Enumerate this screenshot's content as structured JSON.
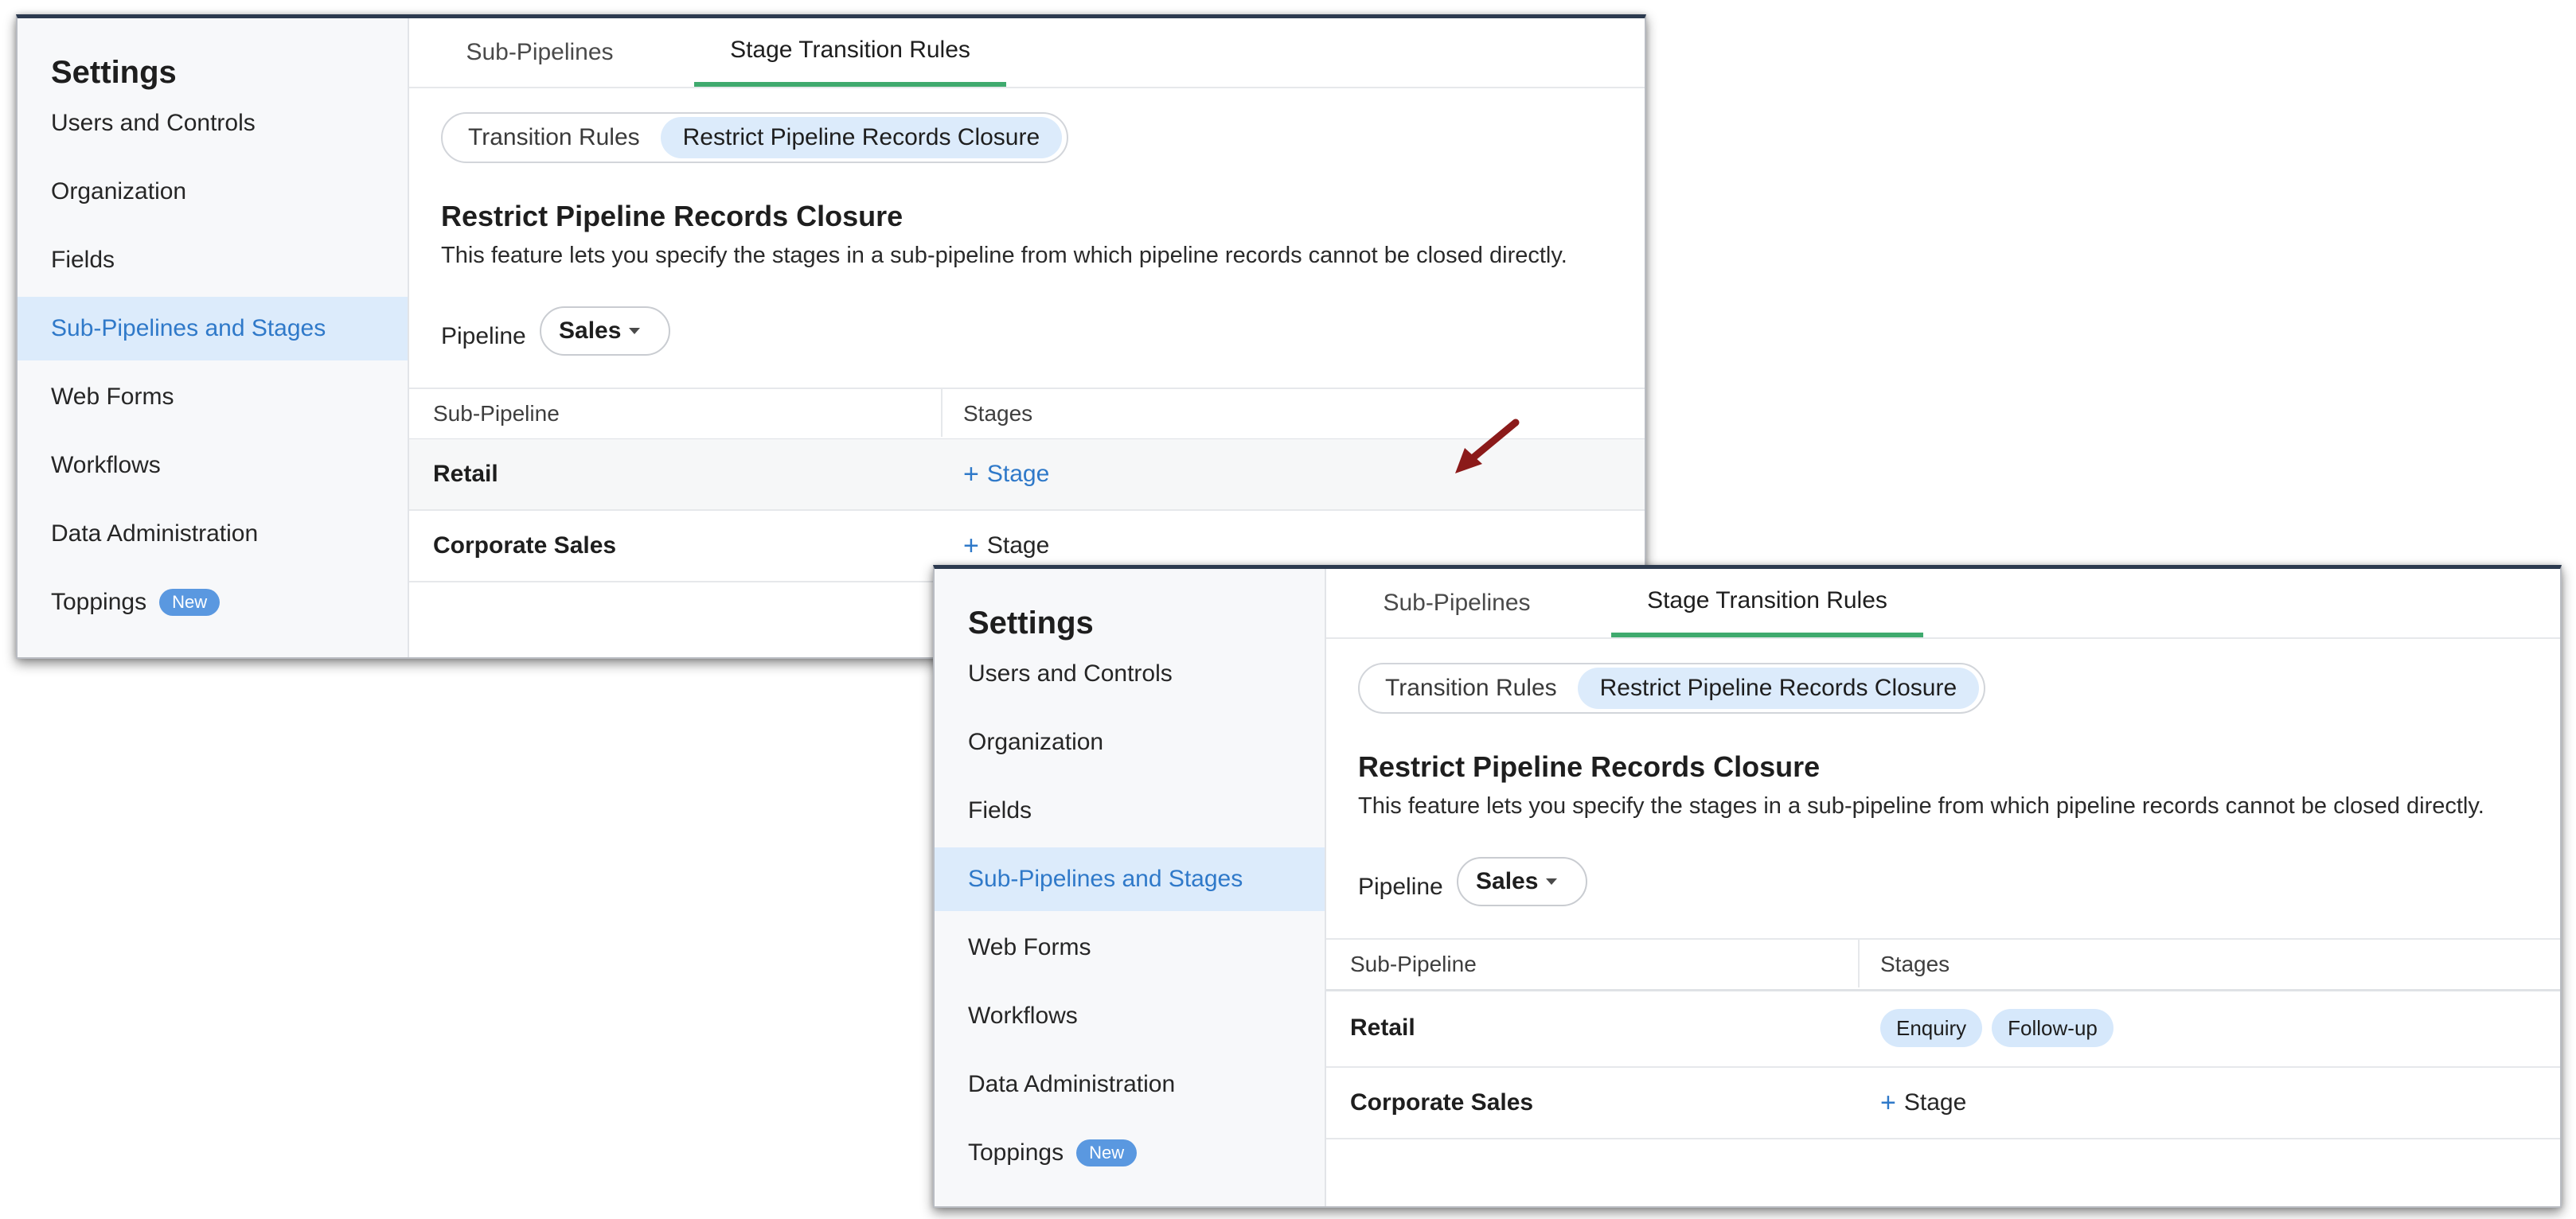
{
  "panels": [
    {
      "sidebar": {
        "title": "Settings",
        "items": [
          {
            "label": "Users and Controls"
          },
          {
            "label": "Organization"
          },
          {
            "label": "Fields"
          },
          {
            "label": "Sub-Pipelines and Stages",
            "active": true
          },
          {
            "label": "Web Forms"
          },
          {
            "label": "Workflows"
          },
          {
            "label": "Data Administration"
          },
          {
            "label": "Toppings",
            "badge": "New"
          }
        ]
      },
      "tabs": [
        "Sub-Pipelines",
        "Stage Transition Rules"
      ],
      "segments": [
        "Transition Rules",
        "Restrict Pipeline Records Closure"
      ],
      "section": {
        "title": "Restrict Pipeline Records Closure",
        "description": "This feature lets you specify the stages in a sub-pipeline from which pipeline records cannot be closed directly."
      },
      "pipeline": {
        "label": "Pipeline",
        "value": "Sales"
      },
      "table": {
        "headers": [
          "Sub-Pipeline",
          "Stages"
        ],
        "rows": [
          {
            "name": "Retail",
            "add_label": "Stage"
          },
          {
            "name": "Corporate Sales",
            "add_label": "Stage"
          }
        ]
      }
    },
    {
      "sidebar": {
        "title": "Settings",
        "items": [
          {
            "label": "Users and Controls"
          },
          {
            "label": "Organization"
          },
          {
            "label": "Fields"
          },
          {
            "label": "Sub-Pipelines and Stages",
            "active": true
          },
          {
            "label": "Web Forms"
          },
          {
            "label": "Workflows"
          },
          {
            "label": "Data Administration"
          },
          {
            "label": "Toppings",
            "badge": "New"
          }
        ]
      },
      "tabs": [
        "Sub-Pipelines",
        "Stage Transition Rules"
      ],
      "segments": [
        "Transition Rules",
        "Restrict Pipeline Records Closure"
      ],
      "section": {
        "title": "Restrict Pipeline Records Closure",
        "description": "This feature lets you specify the stages in a sub-pipeline from which pipeline records cannot be closed directly."
      },
      "pipeline": {
        "label": "Pipeline",
        "value": "Sales"
      },
      "table": {
        "headers": [
          "Sub-Pipeline",
          "Stages"
        ],
        "rows": [
          {
            "name": "Retail",
            "chips": [
              "Enquiry",
              "Follow-up"
            ]
          },
          {
            "name": "Corporate Sales",
            "add_label": "Stage"
          }
        ]
      }
    }
  ],
  "colors": {
    "accent": "#2f79c9",
    "active_bg": "#dcebfb",
    "tab_underline": "#3faa6e",
    "badge": "#5a98e0",
    "annotation_arrow": "#8b1a1a"
  },
  "icons": {
    "plus": "plus-icon",
    "caret": "chevron-down-icon",
    "annotation": "arrow-annotation-icon"
  }
}
